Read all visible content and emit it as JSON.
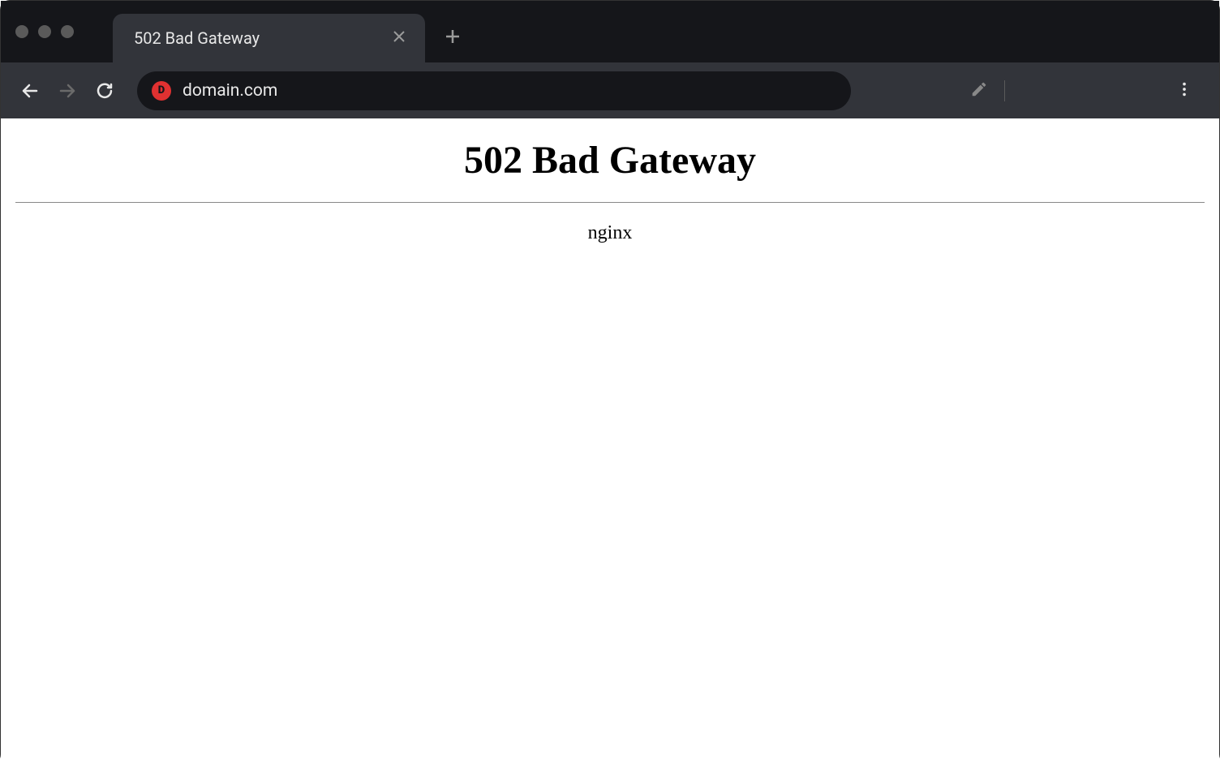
{
  "tab": {
    "title": "502 Bad Gateway"
  },
  "address": {
    "url": "domain.com"
  },
  "page": {
    "heading": "502 Bad Gateway",
    "server": "nginx"
  }
}
